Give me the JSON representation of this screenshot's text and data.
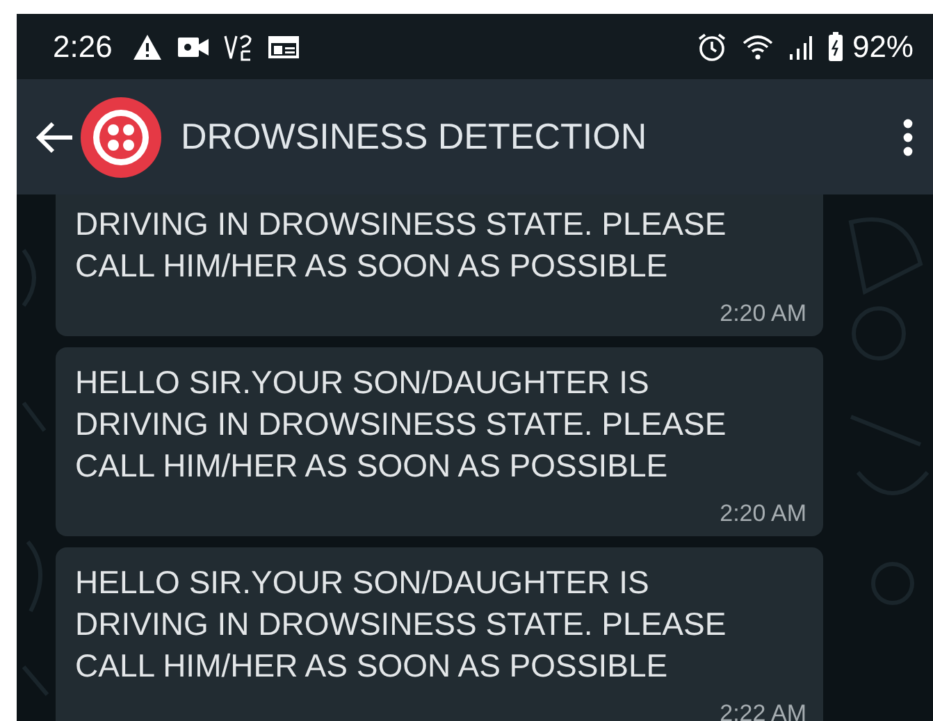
{
  "status_bar": {
    "time": "2:26",
    "battery": "92%"
  },
  "app_bar": {
    "title": "DROWSINESS DETECTION"
  },
  "messages": [
    {
      "text": "DRIVING IN DROWSINESS STATE. PLEASE\nCALL HIM/HER AS SOON AS POSSIBLE",
      "time": "2:20 AM",
      "cut_top": true
    },
    {
      "text": "HELLO SIR.YOUR SON/DAUGHTER IS\nDRIVING IN DROWSINESS STATE. PLEASE\nCALL HIM/HER AS SOON AS POSSIBLE",
      "time": "2:20 AM",
      "cut_top": false
    },
    {
      "text": "HELLO SIR.YOUR SON/DAUGHTER IS\nDRIVING IN DROWSINESS STATE. PLEASE\nCALL HIM/HER AS SOON AS POSSIBLE",
      "time": "2:22 AM",
      "cut_top": false
    }
  ]
}
